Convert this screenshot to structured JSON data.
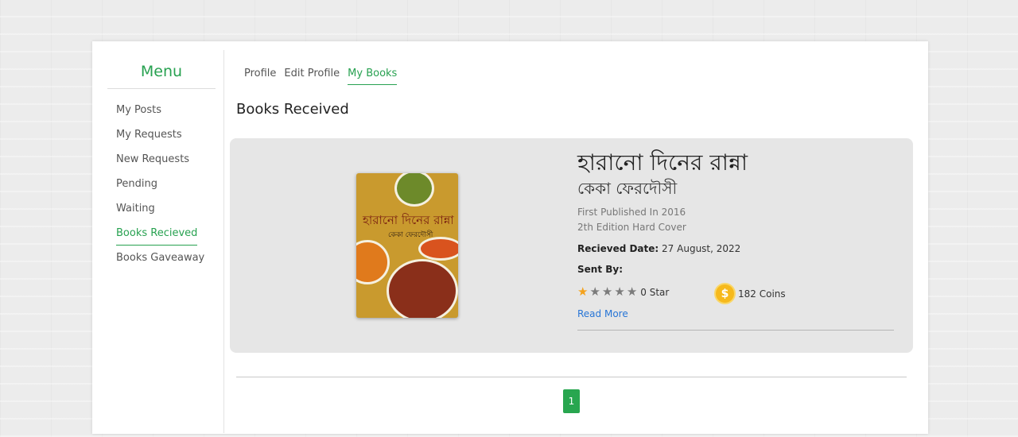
{
  "menu": {
    "title": "Menu",
    "items": [
      {
        "label": "My Posts"
      },
      {
        "label": "My Requests"
      },
      {
        "label": "New Requests"
      },
      {
        "label": "Pending"
      },
      {
        "label": "Waiting"
      },
      {
        "label": "Books Recieved",
        "active": true
      },
      {
        "label": "Books Gaveaway"
      }
    ]
  },
  "tabs": [
    {
      "label": "Profile"
    },
    {
      "label": "Edit Profile"
    },
    {
      "label": "My Books",
      "active": true
    }
  ],
  "section_title": "Books Received",
  "book": {
    "title": "হারানো দিনের রান্না",
    "author": "কেকা ফেরদৌসী",
    "published": "First Published In 2016",
    "edition": "2th Edition Hard Cover",
    "received_label": "Recieved Date:",
    "received_date": "27 August, 2022",
    "sent_by_label": "Sent By:",
    "rating": 0,
    "rating_max": 5,
    "rating_text": "0 Star",
    "coins_text": "182 Coins",
    "coin_symbol": "$",
    "read_more": "Read More",
    "cover_title": "হারানো দিনের রান্না",
    "cover_author": "কেকা ফেরদৌসী"
  },
  "pagination": {
    "current": "1"
  },
  "colors": {
    "accent": "#27a150",
    "link": "#2775d6",
    "star_filled": "#f4a21d",
    "star_empty": "#7b7b7b",
    "coin": "#f6b91c"
  }
}
